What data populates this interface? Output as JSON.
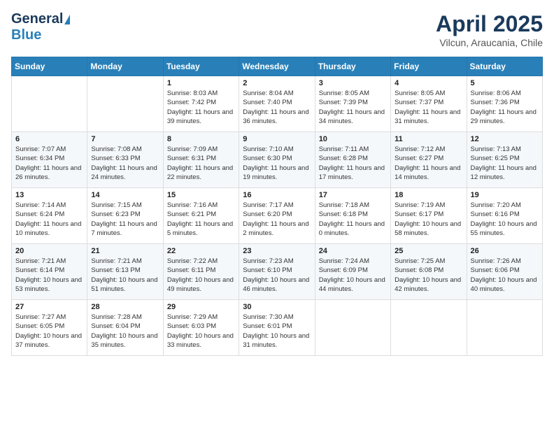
{
  "header": {
    "logo_general": "General",
    "logo_blue": "Blue",
    "title": "April 2025",
    "subtitle": "Vilcun, Araucania, Chile"
  },
  "weekdays": [
    "Sunday",
    "Monday",
    "Tuesday",
    "Wednesday",
    "Thursday",
    "Friday",
    "Saturday"
  ],
  "weeks": [
    [
      {
        "day": "",
        "info": ""
      },
      {
        "day": "",
        "info": ""
      },
      {
        "day": "1",
        "info": "Sunrise: 8:03 AM\nSunset: 7:42 PM\nDaylight: 11 hours and 39 minutes."
      },
      {
        "day": "2",
        "info": "Sunrise: 8:04 AM\nSunset: 7:40 PM\nDaylight: 11 hours and 36 minutes."
      },
      {
        "day": "3",
        "info": "Sunrise: 8:05 AM\nSunset: 7:39 PM\nDaylight: 11 hours and 34 minutes."
      },
      {
        "day": "4",
        "info": "Sunrise: 8:05 AM\nSunset: 7:37 PM\nDaylight: 11 hours and 31 minutes."
      },
      {
        "day": "5",
        "info": "Sunrise: 8:06 AM\nSunset: 7:36 PM\nDaylight: 11 hours and 29 minutes."
      }
    ],
    [
      {
        "day": "6",
        "info": "Sunrise: 7:07 AM\nSunset: 6:34 PM\nDaylight: 11 hours and 26 minutes."
      },
      {
        "day": "7",
        "info": "Sunrise: 7:08 AM\nSunset: 6:33 PM\nDaylight: 11 hours and 24 minutes."
      },
      {
        "day": "8",
        "info": "Sunrise: 7:09 AM\nSunset: 6:31 PM\nDaylight: 11 hours and 22 minutes."
      },
      {
        "day": "9",
        "info": "Sunrise: 7:10 AM\nSunset: 6:30 PM\nDaylight: 11 hours and 19 minutes."
      },
      {
        "day": "10",
        "info": "Sunrise: 7:11 AM\nSunset: 6:28 PM\nDaylight: 11 hours and 17 minutes."
      },
      {
        "day": "11",
        "info": "Sunrise: 7:12 AM\nSunset: 6:27 PM\nDaylight: 11 hours and 14 minutes."
      },
      {
        "day": "12",
        "info": "Sunrise: 7:13 AM\nSunset: 6:25 PM\nDaylight: 11 hours and 12 minutes."
      }
    ],
    [
      {
        "day": "13",
        "info": "Sunrise: 7:14 AM\nSunset: 6:24 PM\nDaylight: 11 hours and 10 minutes."
      },
      {
        "day": "14",
        "info": "Sunrise: 7:15 AM\nSunset: 6:23 PM\nDaylight: 11 hours and 7 minutes."
      },
      {
        "day": "15",
        "info": "Sunrise: 7:16 AM\nSunset: 6:21 PM\nDaylight: 11 hours and 5 minutes."
      },
      {
        "day": "16",
        "info": "Sunrise: 7:17 AM\nSunset: 6:20 PM\nDaylight: 11 hours and 2 minutes."
      },
      {
        "day": "17",
        "info": "Sunrise: 7:18 AM\nSunset: 6:18 PM\nDaylight: 11 hours and 0 minutes."
      },
      {
        "day": "18",
        "info": "Sunrise: 7:19 AM\nSunset: 6:17 PM\nDaylight: 10 hours and 58 minutes."
      },
      {
        "day": "19",
        "info": "Sunrise: 7:20 AM\nSunset: 6:16 PM\nDaylight: 10 hours and 55 minutes."
      }
    ],
    [
      {
        "day": "20",
        "info": "Sunrise: 7:21 AM\nSunset: 6:14 PM\nDaylight: 10 hours and 53 minutes."
      },
      {
        "day": "21",
        "info": "Sunrise: 7:21 AM\nSunset: 6:13 PM\nDaylight: 10 hours and 51 minutes."
      },
      {
        "day": "22",
        "info": "Sunrise: 7:22 AM\nSunset: 6:11 PM\nDaylight: 10 hours and 49 minutes."
      },
      {
        "day": "23",
        "info": "Sunrise: 7:23 AM\nSunset: 6:10 PM\nDaylight: 10 hours and 46 minutes."
      },
      {
        "day": "24",
        "info": "Sunrise: 7:24 AM\nSunset: 6:09 PM\nDaylight: 10 hours and 44 minutes."
      },
      {
        "day": "25",
        "info": "Sunrise: 7:25 AM\nSunset: 6:08 PM\nDaylight: 10 hours and 42 minutes."
      },
      {
        "day": "26",
        "info": "Sunrise: 7:26 AM\nSunset: 6:06 PM\nDaylight: 10 hours and 40 minutes."
      }
    ],
    [
      {
        "day": "27",
        "info": "Sunrise: 7:27 AM\nSunset: 6:05 PM\nDaylight: 10 hours and 37 minutes."
      },
      {
        "day": "28",
        "info": "Sunrise: 7:28 AM\nSunset: 6:04 PM\nDaylight: 10 hours and 35 minutes."
      },
      {
        "day": "29",
        "info": "Sunrise: 7:29 AM\nSunset: 6:03 PM\nDaylight: 10 hours and 33 minutes."
      },
      {
        "day": "30",
        "info": "Sunrise: 7:30 AM\nSunset: 6:01 PM\nDaylight: 10 hours and 31 minutes."
      },
      {
        "day": "",
        "info": ""
      },
      {
        "day": "",
        "info": ""
      },
      {
        "day": "",
        "info": ""
      }
    ]
  ]
}
